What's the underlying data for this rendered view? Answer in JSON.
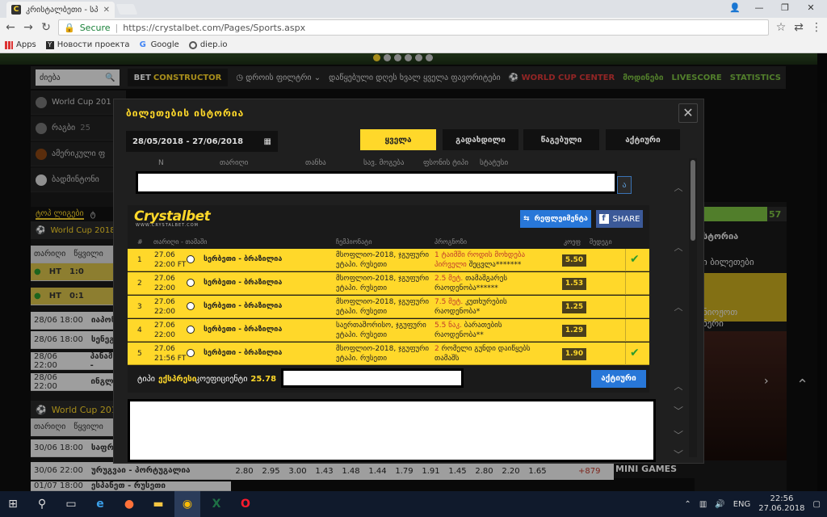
{
  "browser": {
    "tab_title": "კრისტალბეთი - სპორ",
    "secure_label": "Secure",
    "url": "https://crystalbet.com/Pages/Sports.aspx",
    "bookmarks": [
      "Apps",
      "Новости проекта",
      "Google",
      "diep.io"
    ]
  },
  "site": {
    "search_placeholder": "ძიება",
    "bet_constructor": "BET",
    "bet_constructor_b": "CONSTRUCTOR",
    "time_filter": "დროის ფილტრი",
    "nav_text": "დაწყებული დღეს ხვალ ყველა ფავორიტები",
    "world_cup_center": "WORLD CUP CENTER",
    "links": [
      "მოდინები",
      "LIVESCORE",
      "STATISTICS"
    ],
    "left_sports": [
      {
        "label": "World Cup 201"
      },
      {
        "label": "რაგბი",
        "count": "25"
      },
      {
        "label": "ამერიკული ფ"
      },
      {
        "label": "ბადმინტონი"
      }
    ],
    "tabs": [
      "ტოპ ლიგები",
      "ტ"
    ],
    "wc2018": "World Cup 2018",
    "col_date": "თარიღი",
    "col_event": "წყვილი",
    "live_rows": [
      {
        "tag": "HT",
        "score": "1:0"
      },
      {
        "tag": "HT",
        "score": "0:1"
      }
    ],
    "match_rows": [
      {
        "time": "28/06 18:00",
        "name": "იაპონი"
      },
      {
        "time": "28/06 18:00",
        "name": "სენეგა"
      },
      {
        "time": "28/06 22:00",
        "name": "პანამა -"
      },
      {
        "time": "28/06 22:00",
        "name": "ინგლის"
      }
    ],
    "lower_rows": [
      {
        "time": "30/06 18:00",
        "name": "საფრან"
      },
      {
        "time": "30/06 22:00",
        "name": "ურუგვაი - პორტუგალია"
      },
      {
        "time": "01/07 18:00",
        "name": "ესპანეთ - რუსეთი"
      }
    ],
    "odds": [
      "2.80",
      "2.95",
      "3.00",
      "1.43",
      "1.48",
      "1.44",
      "1.79",
      "1.91",
      "1.45",
      "2.80",
      "2.20",
      "1.65"
    ],
    "odds_plus": "+879",
    "side_count": "57",
    "side_header": "სტორია",
    "side_text1": "ი ბილეთები",
    "side_text2": "ნიოჟოთ",
    "side_text3": "ნერი",
    "mini_games": "MINI GAMES"
  },
  "modal": {
    "title": "ბილეთების ისტორია",
    "date_range": "28/05/2018 - 27/06/2018",
    "filters": [
      "ყველა",
      "გადახდილი",
      "წაგებული",
      "აქტიური"
    ],
    "columns": [
      "N",
      "თარიღი",
      "თანხა",
      "სავ. მოგება",
      "ფსონის ტიპი",
      "სტატუსი"
    ]
  },
  "ticket": {
    "logo": "Crystalbet",
    "logo_sub": "WWW.CRYSTALBET.COM",
    "rebet": "რეფლეიმენტა",
    "share": "SHARE",
    "headers": [
      "#",
      "თარიღი - თამაში",
      "ჩემპიონატი",
      "პროგნოზი",
      "კოეფ",
      "შედეგი"
    ],
    "rows": [
      {
        "n": "1",
        "date": "27.06",
        "time": "22:00 FT",
        "match": "სერბეთი - ბრაზილია",
        "tour": "მსოფლიო-2018, ჯგუფური ეტაპი. რუსეთი",
        "pred_red": "1 ტაიმში როდის მოხდება პირველი",
        "pred_black": "შეცვლა*******",
        "odd": "5.50",
        "ok": true
      },
      {
        "n": "2",
        "date": "27.06",
        "time": "22:00",
        "match": "სერბეთი - ბრაზილია",
        "tour": "მსოფლიო-2018, ჯგუფური ეტაპი. რუსეთი",
        "pred_red": "2.5 მეტ.",
        "pred_black": "თამაშგარეს რაოდენობა******",
        "odd": "1.53",
        "ok": false
      },
      {
        "n": "3",
        "date": "27.06",
        "time": "22:00",
        "match": "სერბეთი - ბრაზილია",
        "tour": "მსოფლიო-2018, ჯგუფური ეტაპი. რუსეთი",
        "pred_red": "7.5 მეტ.",
        "pred_black": "კუთხურების რაოდენობა*",
        "odd": "1.25",
        "ok": false
      },
      {
        "n": "4",
        "date": "27.06",
        "time": "22:00",
        "match": "სერბეთი - ბრაზილია",
        "tour": "საერთაშორისო, ჯგუფური ეტაპი. რუსეთი",
        "pred_red": "5.5 ნაკ.",
        "pred_black": "ბარათების რაოდენობა**",
        "odd": "1.29",
        "ok": false
      },
      {
        "n": "5",
        "date": "27.06",
        "time": "21:56 FT",
        "match": "სერბეთი - ბრაზილია",
        "tour": "მსოფლიო-2018, ჯგუფური ეტაპი. რუსეთი",
        "pred_red": "2",
        "pred_black": "რომელი გუნდი დაიწყებს თამაშს",
        "odd": "1.90",
        "ok": true
      }
    ],
    "type_label": "ტიპი",
    "type_value": "ექსპრესი",
    "coef_label": "კოეფიციენტი",
    "coef_value": "25.78",
    "active_btn": "აქტიური"
  },
  "taskbar": {
    "lang": "ENG",
    "time": "22:56",
    "date": "27.06.2018"
  }
}
